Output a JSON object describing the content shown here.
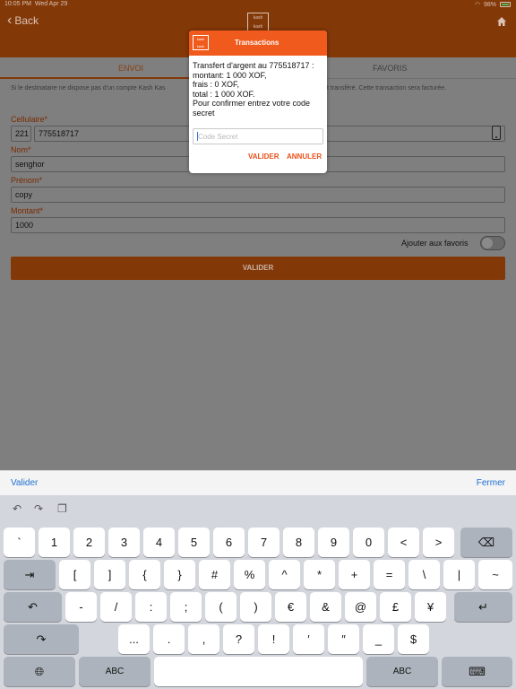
{
  "status": {
    "time": "10:05 PM",
    "date": "Wed Apr 29",
    "battery": "98%"
  },
  "nav": {
    "back_label": "Back",
    "logo_text": "kash kash"
  },
  "tabs": {
    "envoi": "ENVOI",
    "favoris": "FAVORIS"
  },
  "form": {
    "info": "Si le destinataire ne dispose pas d'un compte Kash Kas",
    "info_tail": "t transféré. Cette transaction sera facturée.",
    "cellulaire_label": "Cellulaire*",
    "country_code": "221",
    "phone": "775518717",
    "nom_label": "Nom*",
    "nom": "senghor",
    "prenom_label": "Prénom*",
    "prenom": "copy",
    "montant_label": "Montant*",
    "montant": "1000",
    "favoris_label": "Ajouter aux favoris",
    "valider_label": "VALIDER"
  },
  "dialog": {
    "title": "Transactions",
    "logo_text": "kash kash",
    "lines": [
      "Transfert d'argent au 775518717 :",
      "montant: 1 000 XOF,",
      "frais : 0 XOF,",
      "total :  1 000 XOF.",
      "Pour confirmer entrez votre code",
      "secret"
    ],
    "input_placeholder": "Code Secret",
    "valider": "VALIDER",
    "annuler": "ANNULER"
  },
  "accessory": {
    "left": "Valider",
    "right": "Fermer"
  },
  "keyboard": {
    "row1": [
      "`",
      "1",
      "2",
      "3",
      "4",
      "5",
      "6",
      "7",
      "8",
      "9",
      "0",
      "<",
      ">"
    ],
    "row2": [
      "[",
      "]",
      "{",
      "}",
      "#",
      "%",
      "^",
      "*",
      "+",
      "=",
      "\\",
      "|",
      "~"
    ],
    "row3": [
      "-",
      "/",
      ":",
      ";",
      "(",
      ")",
      "€",
      "&",
      "@",
      "£",
      "¥"
    ],
    "row4": [
      "...",
      ".",
      ",",
      "?",
      "!",
      "′",
      "″",
      "_",
      "$"
    ],
    "abc": "ABC"
  },
  "colors": {
    "brand_orange": "#f05a1c",
    "dimmed_orange": "#833808",
    "link_blue": "#1f6fd0"
  }
}
